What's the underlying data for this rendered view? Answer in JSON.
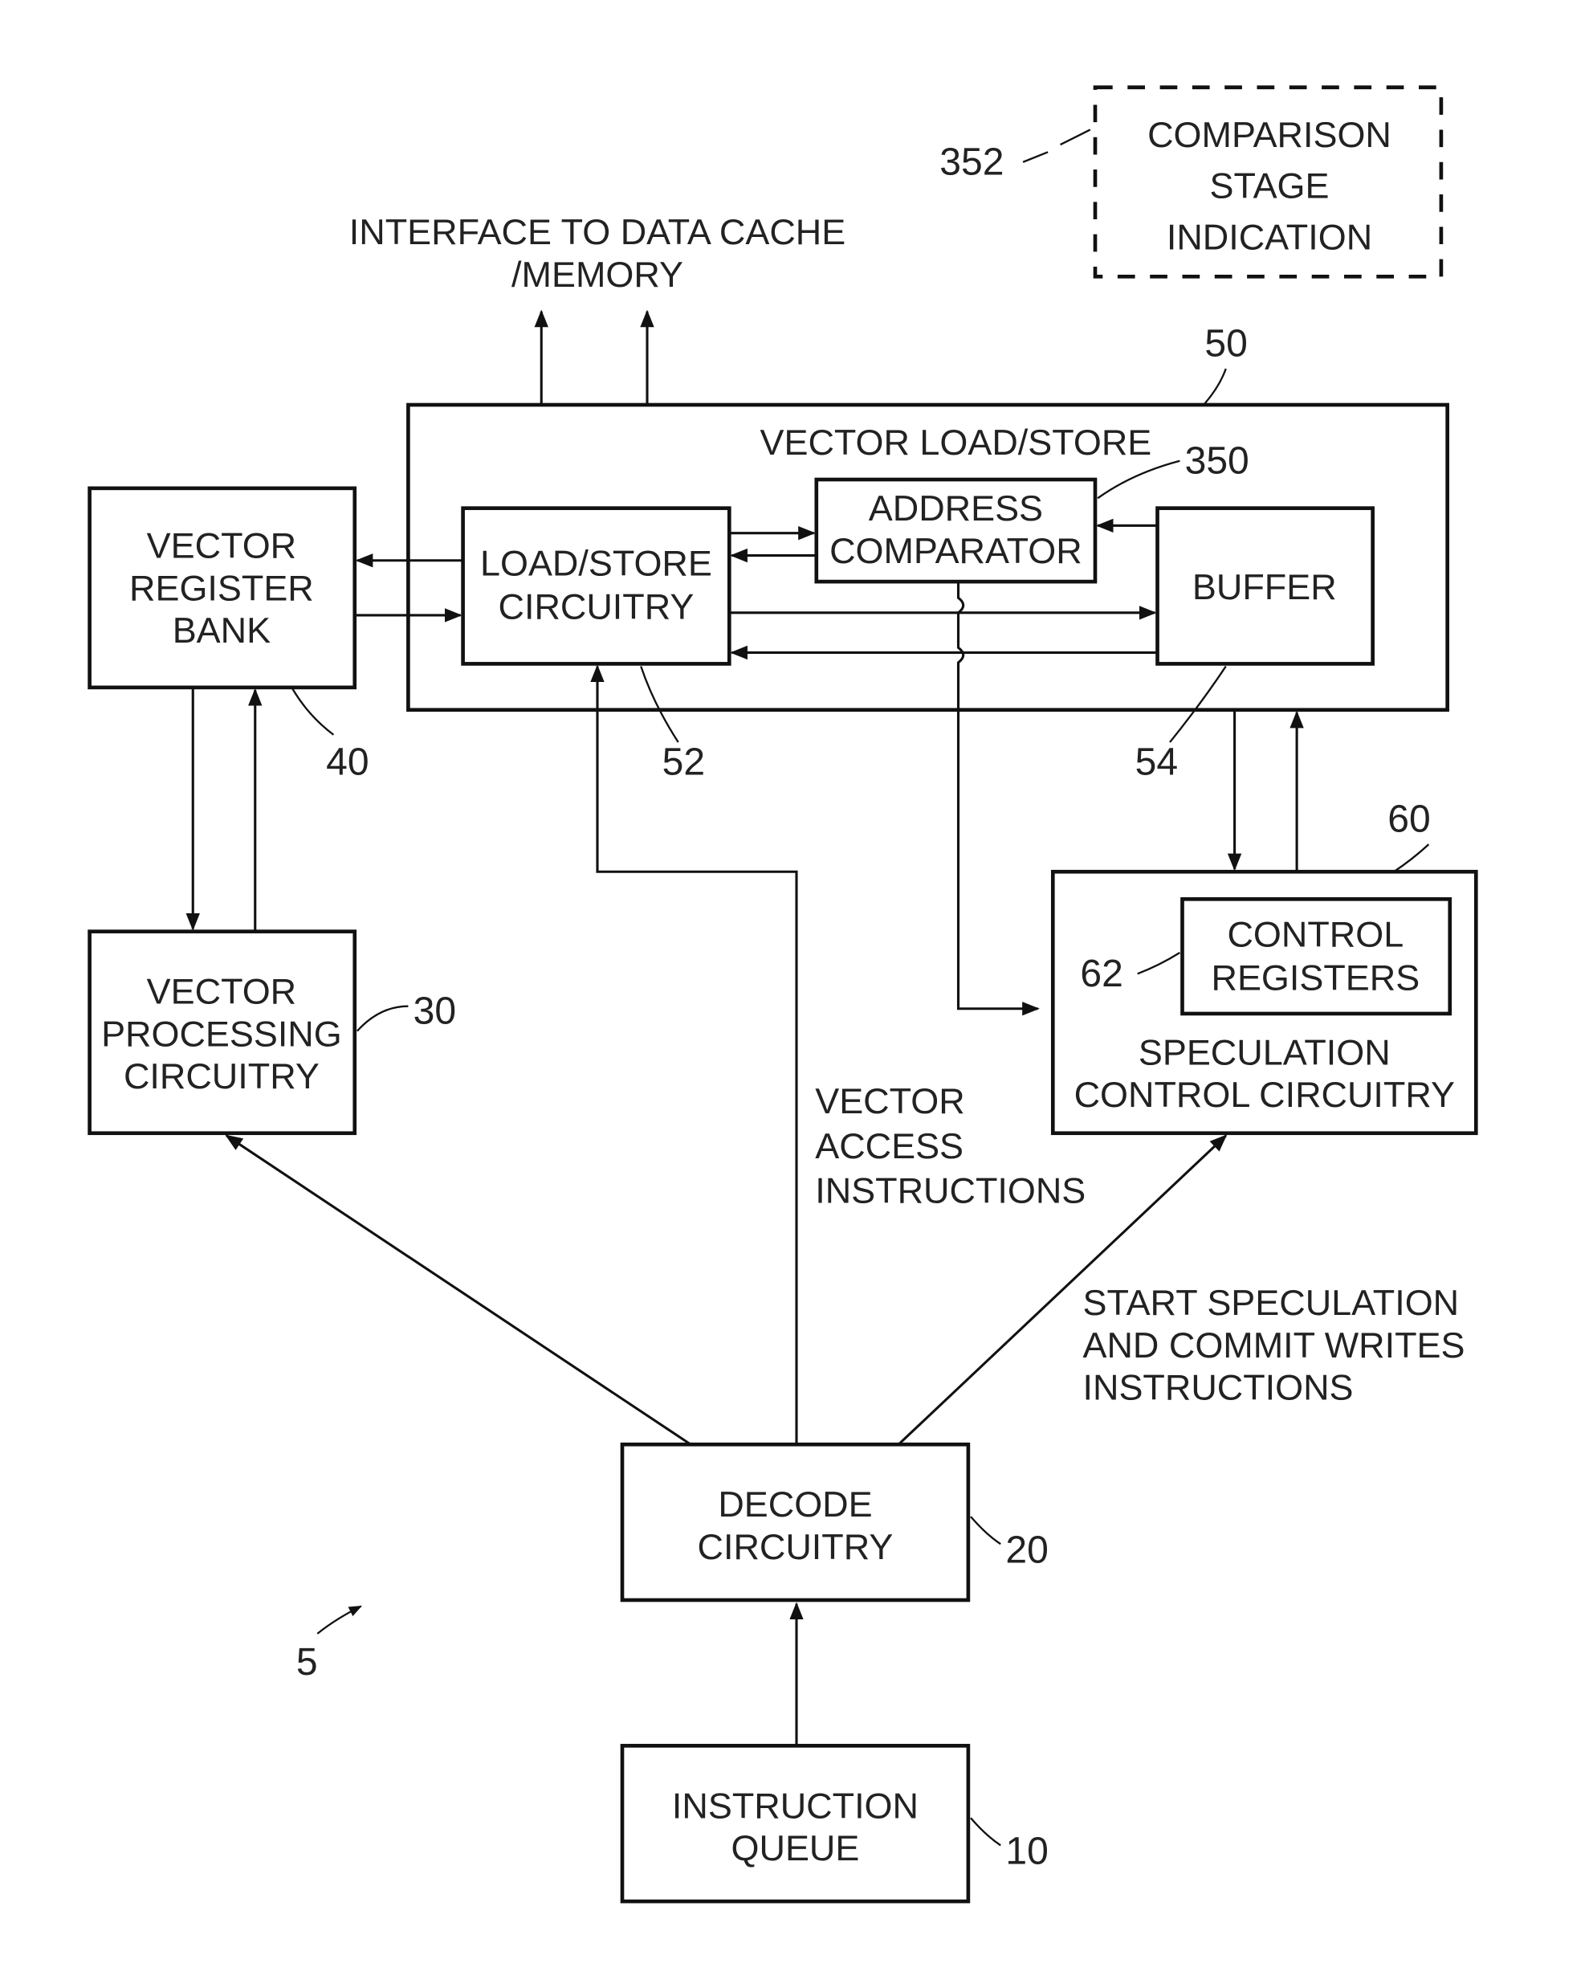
{
  "figure": {
    "comparison_stage": {
      "ref": "352",
      "lines": [
        "COMPARISON",
        "STAGE",
        "INDICATION"
      ]
    },
    "interface_label": [
      "INTERFACE TO DATA CACHE",
      "/MEMORY"
    ],
    "vector_load_store": {
      "ref": "50",
      "title": "VECTOR LOAD/STORE"
    },
    "address_comparator": {
      "ref": "350",
      "lines": [
        "ADDRESS",
        "COMPARATOR"
      ]
    },
    "load_store_circuitry": {
      "ref": "52",
      "lines": [
        "LOAD/STORE",
        "CIRCUITRY"
      ]
    },
    "buffer": {
      "ref": "54",
      "lines": [
        "BUFFER"
      ]
    },
    "vector_register_bank": {
      "ref": "40",
      "lines": [
        "VECTOR",
        "REGISTER",
        "BANK"
      ]
    },
    "vector_processing_circuitry": {
      "ref": "30",
      "lines": [
        "VECTOR",
        "PROCESSING",
        "CIRCUITRY"
      ]
    },
    "speculation_control": {
      "ref": "60",
      "lines": [
        "SPECULATION",
        "CONTROL CIRCUITRY"
      ]
    },
    "control_registers": {
      "ref": "62",
      "lines": [
        "CONTROL",
        "REGISTERS"
      ]
    },
    "vector_access_label": [
      "VECTOR",
      "ACCESS",
      "INSTRUCTIONS"
    ],
    "start_speculation_label": [
      "START SPECULATION",
      "AND COMMIT WRITES",
      "INSTRUCTIONS"
    ],
    "decode_circuitry": {
      "ref": "20",
      "lines": [
        "DECODE",
        "CIRCUITRY"
      ]
    },
    "instruction_queue": {
      "ref": "10",
      "lines": [
        "INSTRUCTION",
        "QUEUE"
      ]
    },
    "system_ref": "5"
  }
}
